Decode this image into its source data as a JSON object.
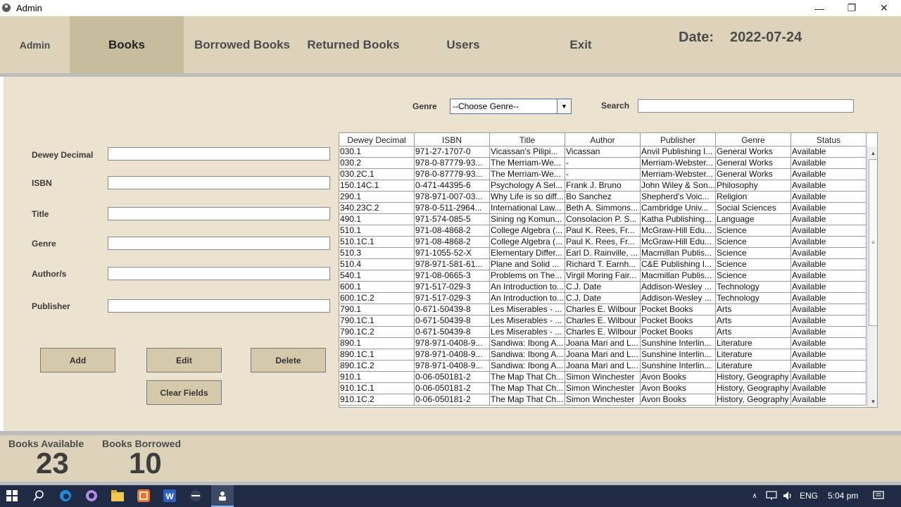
{
  "window": {
    "title": "Admin",
    "minimize_glyph": "—",
    "restore_glyph": "❐",
    "close_glyph": "✕"
  },
  "nav": {
    "items": [
      {
        "label": "Admin"
      },
      {
        "label": "Books",
        "active": true
      },
      {
        "label": "Borrowed Books"
      },
      {
        "label": "Returned Books"
      },
      {
        "label": "Users"
      },
      {
        "label": "Exit"
      }
    ],
    "date_label": "Date:",
    "date_value": "2022-07-24"
  },
  "filters": {
    "genre_label": "Genre",
    "genre_value": "--Choose Genre--",
    "search_label": "Search",
    "search_value": ""
  },
  "form": {
    "fields": [
      {
        "label": "Dewey Decimal",
        "value": ""
      },
      {
        "label": "ISBN",
        "value": ""
      },
      {
        "label": "Title",
        "value": ""
      },
      {
        "label": "Genre",
        "value": ""
      },
      {
        "label": "Author/s",
        "value": ""
      },
      {
        "label": "Publisher",
        "value": ""
      }
    ],
    "buttons": {
      "add": "Add",
      "edit": "Edit",
      "delete": "Delete",
      "clear": "Clear Fields"
    }
  },
  "table": {
    "columns": [
      "Dewey Decimal",
      "ISBN",
      "Title",
      "Author",
      "Publisher",
      "Genre",
      "Status"
    ],
    "rows": [
      [
        "030.1",
        "971-27-1707-0",
        "Vicassan's Pilipi...",
        "Vicassan",
        "Anvil Publishing I...",
        "General Works",
        "Available"
      ],
      [
        "030.2",
        "978-0-87779-93...",
        "The Merriam-We...",
        "-",
        "Merriam-Webster...",
        "General Works",
        "Available"
      ],
      [
        "030.2C.1",
        "978-0-87779-93...",
        "The Merriam-We...",
        "-",
        "Merriam-Webster...",
        "General Works",
        "Available"
      ],
      [
        "150.14C.1",
        "0-471-44395-6",
        "Psychology A Sel...",
        "Frank J. Bruno",
        "John Wiley & Son...",
        "Philosophy",
        "Available"
      ],
      [
        "290.1",
        "978-971-007-03...",
        "Why Life is so diff...",
        "Bo Sanchez",
        "Shepherd's Voic...",
        "Religion",
        "Available"
      ],
      [
        "340.23C.2",
        "978-0-511-2964...",
        "International Law...",
        "Beth A. Simmons...",
        "Cambridge Univ...",
        "Social Sciences",
        "Available"
      ],
      [
        "490.1",
        "971-574-085-5",
        "Sining ng Komun...",
        "Consolacion P. S...",
        "Katha Publishing...",
        "Language",
        "Available"
      ],
      [
        "510.1",
        "971-08-4868-2",
        "College Algebra (...",
        "Paul K. Rees, Fr...",
        "McGraw-Hill Edu...",
        "Science",
        "Available"
      ],
      [
        "510.1C.1",
        "971-08-4868-2",
        "College Algebra (...",
        "Paul K. Rees, Fr...",
        "McGraw-Hill Edu...",
        "Science",
        "Available"
      ],
      [
        "510.3",
        "971-1055-52-X",
        "Elementary Differ...",
        "Earl D. Rainville, ...",
        "Macmillan Publis...",
        "Science",
        "Available"
      ],
      [
        "510.4",
        "978-971-581-61...",
        "Plane and Solid ...",
        "Richard T. Earnh...",
        "C&E Publishing I...",
        "Science",
        "Available"
      ],
      [
        "540.1",
        "971-08-0665-3",
        "Problems on The...",
        "Virgil Moring Fair...",
        "Macmillan Publis...",
        "Science",
        "Available"
      ],
      [
        "600.1",
        "971-517-029-3",
        "An Introduction to...",
        "C.J. Date",
        "Addison-Wesley ...",
        "Technology",
        "Available"
      ],
      [
        "600.1C.2",
        "971-517-029-3",
        "An Introduction to...",
        "C.J. Date",
        "Addison-Wesley ...",
        "Technology",
        "Available"
      ],
      [
        "790.1",
        "0-671-50439-8",
        "Les Miserables - ...",
        "Charles E. Wilbour",
        "Pocket Books",
        "Arts",
        "Available"
      ],
      [
        "790.1C.1",
        "0-671-50439-8",
        "Les Miserables - ...",
        "Charles E. Wilbour",
        "Pocket Books",
        "Arts",
        "Available"
      ],
      [
        "790.1C.2",
        "0-671-50439-8",
        "Les Miserables - ...",
        "Charles E. Wilbour",
        "Pocket Books",
        "Arts",
        "Available"
      ],
      [
        "890.1",
        "978-971-0408-9...",
        "Sandiwa: Ibong A...",
        "Joana Mari and L...",
        "Sunshine Interlin...",
        "Literature",
        "Available"
      ],
      [
        "890.1C.1",
        "978-971-0408-9...",
        "Sandiwa: Ibong A...",
        "Joana Mari and L...",
        "Sunshine Interlin...",
        "Literature",
        "Available"
      ],
      [
        "890.1C.2",
        "978-971-0408-9...",
        "Sandiwa: Ibong A...",
        "Joana Mari and L...",
        "Sunshine Interlin...",
        "Literature",
        "Available"
      ],
      [
        "910.1",
        "0-06-050181-2",
        "The Map That Ch...",
        "Simon Winchester",
        "Avon Books",
        "History, Geography",
        "Available"
      ],
      [
        "910.1C.1",
        "0-06-050181-2",
        "The Map That Ch...",
        "Simon Winchester",
        "Avon Books",
        "History, Geography",
        "Available"
      ],
      [
        "910.1C.2",
        "0-06-050181-2",
        "The Map That Ch...",
        "Simon Winchester",
        "Avon Books",
        "History, Geography",
        "Available"
      ]
    ]
  },
  "stats": {
    "available_label": "Books Available",
    "available_value": "23",
    "borrowed_label": "Books Borrowed",
    "borrowed_value": "10"
  },
  "taskbar": {
    "lang": "ENG",
    "time": "5:04 pm",
    "icons": [
      "windows-start-icon",
      "search-icon",
      "edge-browser-icon",
      "app-circle-icon",
      "file-explorer-icon",
      "app-orange-icon",
      "word-icon",
      "app-dark-icon",
      "java-app-icon"
    ]
  }
}
